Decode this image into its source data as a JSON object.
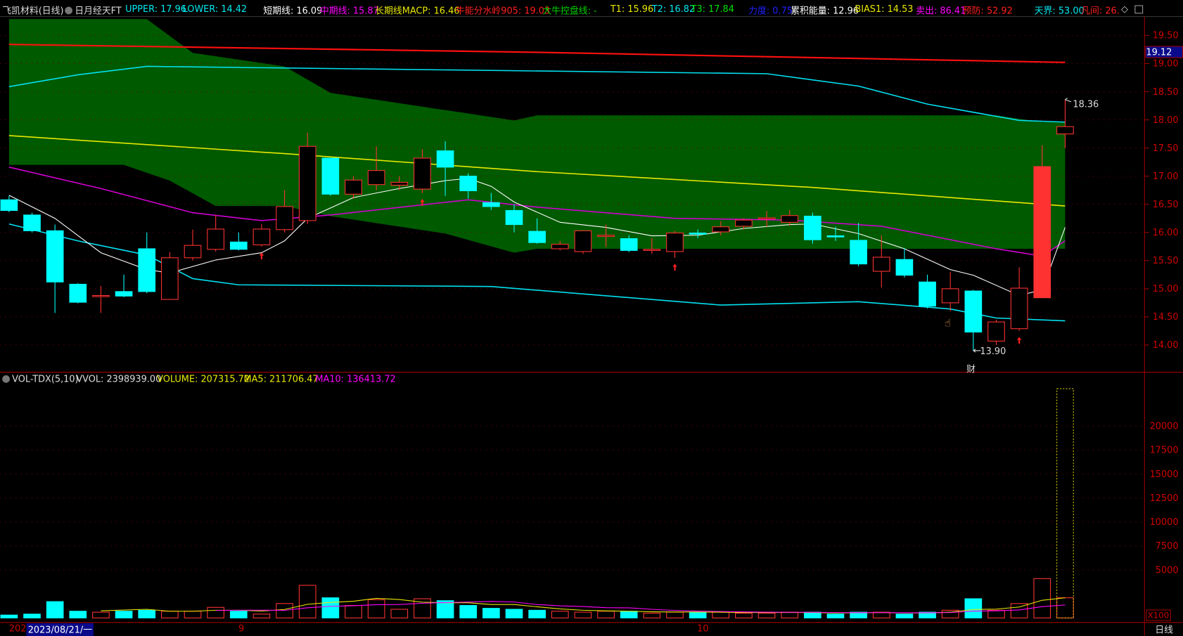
{
  "header": {
    "stock": "飞凯材料(日线)",
    "indicator": "日月经天FT",
    "upper": "UPPER: 17.96",
    "lower": "LOWER: 14.42",
    "short": "短期线: 16.09",
    "mid": "中期线: 15.87",
    "long": "长期线MACP: 16.46",
    "bull905": "牛能分水岭905: 19.03",
    "bullctl": "大牛控盘线: -",
    "t1": "T1: 15.96",
    "t2": "T2: 16.82",
    "t3": "T3: 17.84",
    "force": "力度: 0.75",
    "energy": "累积能量: 12.96",
    "bias": "BIAS1: 14.53",
    "sell": "卖出: 86.41",
    "warn": "预防: 52.92",
    "sky": "天界: 53.00",
    "gap": "凡间: 26.0"
  },
  "volume_header": {
    "name": "VOL-TDX(5,10)",
    "vvol": "VVOL: 2398939.00",
    "volume": "VOLUME: 207315.72",
    "ma5": "MA5: 211706.47",
    "ma10": "MA10: 136413.72"
  },
  "price_axis": {
    "ticks": [
      "19.50",
      "19.00",
      "18.50",
      "18.00",
      "17.50",
      "17.00",
      "16.50",
      "16.00",
      "15.50",
      "15.00",
      "14.50",
      "14.00"
    ],
    "current": "19.12"
  },
  "volume_axis": {
    "ticks": [
      "20000",
      "17500",
      "15000",
      "12500",
      "10000",
      "7500",
      "5000"
    ],
    "unit": "X100"
  },
  "date_axis": {
    "left": "202",
    "selected": "2023/08/21/一",
    "month9": "9",
    "month10": "10",
    "period": "日线"
  },
  "annotations": {
    "high": "18.36",
    "low": "13.90",
    "fin": "财"
  },
  "colors": {
    "up": "#ff3232",
    "down": "#00ffff",
    "band": "#005a00",
    "axis": "#a00000"
  },
  "chart_data": {
    "type": "candlestick",
    "candles": [
      [
        16.58,
        16.65,
        16.36,
        16.39
      ],
      [
        16.31,
        16.35,
        16.0,
        16.03
      ],
      [
        16.03,
        16.14,
        14.57,
        15.12
      ],
      [
        15.08,
        15.1,
        14.74,
        14.76
      ],
      [
        14.87,
        15.05,
        14.57,
        14.88
      ],
      [
        14.95,
        15.25,
        14.85,
        14.87
      ],
      [
        15.71,
        16.0,
        14.92,
        14.95
      ],
      [
        14.81,
        15.65,
        14.81,
        15.55
      ],
      [
        15.55,
        16.05,
        15.5,
        15.77
      ],
      [
        15.7,
        16.31,
        15.66,
        16.06
      ],
      [
        15.83,
        16.0,
        15.68,
        15.7
      ],
      [
        15.78,
        16.15,
        15.75,
        16.06
      ],
      [
        16.05,
        16.75,
        16.0,
        16.46
      ],
      [
        16.21,
        17.77,
        16.15,
        17.53
      ],
      [
        17.32,
        17.32,
        16.65,
        16.68
      ],
      [
        16.68,
        17.0,
        16.6,
        16.93
      ],
      [
        16.85,
        17.53,
        16.75,
        17.1
      ],
      [
        16.84,
        17.0,
        16.75,
        16.89
      ],
      [
        16.77,
        17.48,
        16.7,
        17.32
      ],
      [
        17.45,
        17.62,
        16.65,
        17.16
      ],
      [
        17.0,
        17.05,
        16.6,
        16.74
      ],
      [
        16.53,
        16.7,
        16.4,
        16.46
      ],
      [
        16.39,
        16.5,
        16.0,
        16.14
      ],
      [
        16.02,
        16.25,
        15.8,
        15.82
      ],
      [
        15.71,
        15.85,
        15.68,
        15.79
      ],
      [
        15.66,
        16.03,
        15.62,
        16.03
      ],
      [
        15.93,
        16.14,
        15.74,
        15.95
      ],
      [
        15.89,
        15.95,
        15.65,
        15.68
      ],
      [
        15.68,
        15.9,
        15.62,
        15.7
      ],
      [
        15.66,
        16.03,
        15.55,
        15.99
      ],
      [
        15.99,
        16.05,
        15.9,
        15.97
      ],
      [
        16.01,
        16.2,
        15.95,
        16.1
      ],
      [
        16.11,
        16.25,
        16.05,
        16.22
      ],
      [
        16.24,
        16.38,
        16.1,
        16.26
      ],
      [
        16.18,
        16.4,
        16.12,
        16.3
      ],
      [
        16.29,
        16.35,
        15.8,
        15.87
      ],
      [
        15.94,
        16.1,
        15.85,
        15.92
      ],
      [
        15.86,
        16.17,
        15.4,
        15.44
      ],
      [
        15.31,
        15.95,
        15.02,
        15.56
      ],
      [
        15.52,
        15.72,
        15.2,
        15.24
      ],
      [
        15.12,
        15.25,
        14.65,
        14.69
      ],
      [
        14.75,
        15.3,
        14.6,
        15.0
      ],
      [
        14.96,
        14.98,
        13.9,
        14.23
      ],
      [
        14.07,
        14.45,
        14.0,
        14.41
      ],
      [
        14.29,
        15.38,
        14.25,
        15.01
      ],
      [
        14.84,
        17.55,
        14.84,
        17.17
      ],
      [
        17.75,
        18.36,
        17.5,
        17.88
      ]
    ],
    "volumes": [
      300,
      400,
      1700,
      700,
      600,
      700,
      800,
      700,
      700,
      1100,
      700,
      400,
      1500,
      3400,
      2100,
      1300,
      1900,
      900,
      2000,
      1800,
      1300,
      1000,
      900,
      800,
      700,
      600,
      700,
      700,
      500,
      600,
      600,
      600,
      500,
      500,
      600,
      600,
      400,
      600,
      600,
      400,
      600,
      800,
      2000,
      800,
      1500,
      4100,
      2100
    ],
    "projected_last_volume": 23900,
    "lines": {
      "bull905": {
        "color": "#ff1010",
        "points": [
          [
            0,
            19.34
          ],
          [
            23,
            19.2
          ],
          [
            46,
            19.02
          ]
        ]
      },
      "upper": {
        "color": "#00e0f0",
        "points": [
          [
            0,
            18.59
          ],
          [
            3,
            18.8
          ],
          [
            6,
            18.95
          ],
          [
            33,
            18.82
          ],
          [
            37,
            18.6
          ],
          [
            40,
            18.28
          ],
          [
            44,
            17.99
          ],
          [
            46,
            17.96
          ]
        ]
      },
      "long": {
        "color": "#e8e800",
        "points": [
          [
            0,
            17.72
          ],
          [
            12,
            17.4
          ],
          [
            23,
            17.08
          ],
          [
            35,
            16.8
          ],
          [
            46,
            16.47
          ]
        ]
      },
      "lower": {
        "color": "#00e0f0",
        "points": [
          [
            0,
            16.15
          ],
          [
            3,
            15.85
          ],
          [
            6,
            15.6
          ],
          [
            8,
            15.18
          ],
          [
            10,
            15.07
          ],
          [
            21,
            15.04
          ],
          [
            31,
            14.71
          ],
          [
            37,
            14.77
          ],
          [
            41,
            14.64
          ],
          [
            43,
            14.48
          ],
          [
            46,
            14.43
          ]
        ]
      },
      "mid": {
        "color": "#d000d0",
        "points": [
          [
            0,
            17.16
          ],
          [
            4,
            16.78
          ],
          [
            8,
            16.35
          ],
          [
            11,
            16.21
          ],
          [
            14,
            16.31
          ],
          [
            20,
            16.58
          ],
          [
            23,
            16.45
          ],
          [
            29,
            16.25
          ],
          [
            34,
            16.22
          ],
          [
            38,
            16.11
          ],
          [
            43,
            15.71
          ],
          [
            45,
            15.58
          ],
          [
            46,
            15.85
          ]
        ]
      },
      "short": {
        "color": "#ffffff",
        "points": [
          [
            0,
            16.66
          ],
          [
            2,
            16.25
          ],
          [
            4,
            15.64
          ],
          [
            6,
            15.34
          ],
          [
            7,
            15.28
          ],
          [
            9,
            15.51
          ],
          [
            11,
            15.64
          ],
          [
            12,
            15.85
          ],
          [
            13,
            16.25
          ],
          [
            15,
            16.62
          ],
          [
            17,
            16.78
          ],
          [
            19,
            16.92
          ],
          [
            20,
            16.96
          ],
          [
            21,
            16.82
          ],
          [
            22,
            16.54
          ],
          [
            24,
            16.18
          ],
          [
            26,
            16.09
          ],
          [
            28,
            15.94
          ],
          [
            30,
            15.95
          ],
          [
            32,
            16.07
          ],
          [
            34,
            16.14
          ],
          [
            35,
            16.15
          ],
          [
            37,
            15.98
          ],
          [
            39,
            15.71
          ],
          [
            41,
            15.34
          ],
          [
            42,
            15.24
          ],
          [
            44,
            14.88
          ],
          [
            45,
            14.98
          ],
          [
            46,
            16.09
          ]
        ]
      }
    },
    "band_top": [
      [
        0,
        19.79
      ],
      [
        6,
        19.79
      ],
      [
        8,
        19.19
      ],
      [
        12,
        18.95
      ],
      [
        14,
        18.48
      ],
      [
        22,
        17.99
      ],
      [
        23,
        18.08
      ],
      [
        43,
        18.08
      ],
      [
        45,
        17.96
      ],
      [
        46,
        17.96
      ]
    ],
    "band_bottom": [
      [
        0,
        17.2
      ],
      [
        5,
        17.2
      ],
      [
        7,
        16.92
      ],
      [
        9,
        16.47
      ],
      [
        12,
        16.47
      ],
      [
        14,
        16.29
      ],
      [
        19,
        15.98
      ],
      [
        22,
        15.64
      ],
      [
        23,
        15.71
      ],
      [
        46,
        15.71
      ],
      [
        46,
        15.6
      ]
    ],
    "buy_arrows": [
      11,
      18,
      29,
      44
    ],
    "ylim": [
      13.6,
      19.8
    ]
  }
}
